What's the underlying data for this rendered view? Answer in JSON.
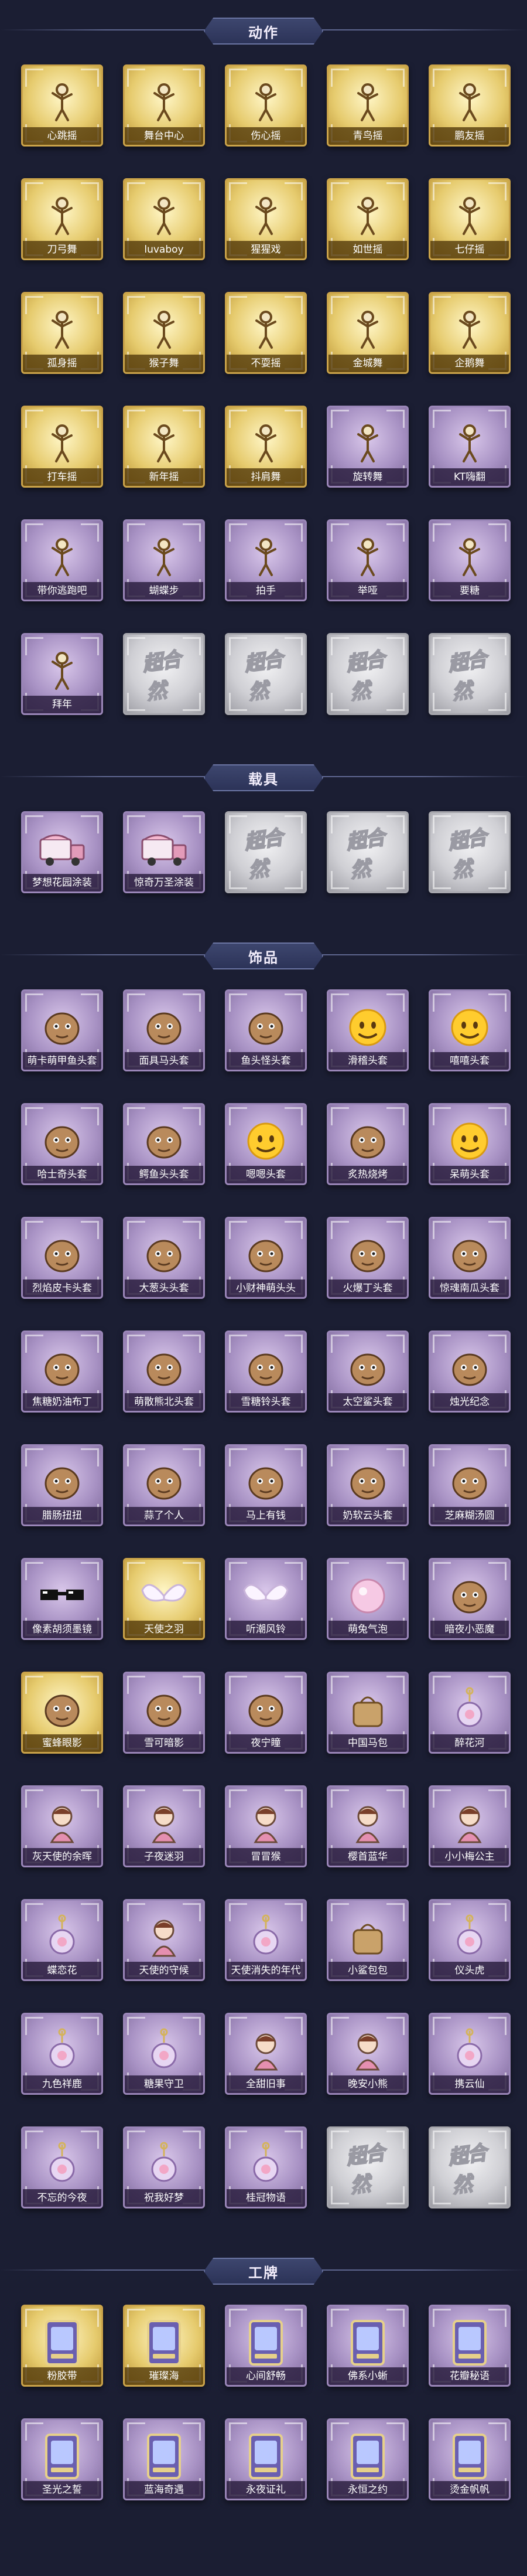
{
  "sections": [
    {
      "title": "动作",
      "items": [
        {
          "label": "心跳摇",
          "tier": "gold",
          "icon": "pose-icon"
        },
        {
          "label": "舞台中心",
          "tier": "gold",
          "icon": "pose-icon"
        },
        {
          "label": "伤心摇",
          "tier": "gold",
          "icon": "pose-icon"
        },
        {
          "label": "青鸟摇",
          "tier": "gold",
          "icon": "pose-icon"
        },
        {
          "label": "鹏友摇",
          "tier": "gold",
          "icon": "pose-icon"
        },
        {
          "label": "刀弓舞",
          "tier": "gold",
          "icon": "pose-icon"
        },
        {
          "label": "luvaboy",
          "tier": "gold",
          "icon": "pose-icon"
        },
        {
          "label": "猩猩戏",
          "tier": "gold",
          "icon": "pose-icon"
        },
        {
          "label": "如世摇",
          "tier": "gold",
          "icon": "pose-icon"
        },
        {
          "label": "七仔摇",
          "tier": "gold",
          "icon": "pose-icon"
        },
        {
          "label": "孤身摇",
          "tier": "gold",
          "icon": "pose-icon"
        },
        {
          "label": "猴子舞",
          "tier": "gold",
          "icon": "pose-icon"
        },
        {
          "label": "不耍摇",
          "tier": "gold",
          "icon": "pose-icon"
        },
        {
          "label": "金城舞",
          "tier": "gold",
          "icon": "pose-icon"
        },
        {
          "label": "企鹅舞",
          "tier": "gold",
          "icon": "pose-icon"
        },
        {
          "label": "打车摇",
          "tier": "gold",
          "icon": "pose-icon"
        },
        {
          "label": "新年摇",
          "tier": "gold",
          "icon": "pose-icon"
        },
        {
          "label": "抖肩舞",
          "tier": "gold",
          "icon": "pose-icon"
        },
        {
          "label": "旋转舞",
          "tier": "purple",
          "icon": "pose-icon"
        },
        {
          "label": "KT嗨翻",
          "tier": "purple",
          "icon": "pose-icon"
        },
        {
          "label": "带你逃跑吧",
          "tier": "purple",
          "icon": "pose-icon"
        },
        {
          "label": "蝴蝶步",
          "tier": "purple",
          "icon": "pose-icon"
        },
        {
          "label": "拍手",
          "tier": "purple",
          "icon": "pose-icon"
        },
        {
          "label": "举哑",
          "tier": "purple",
          "icon": "pose-icon"
        },
        {
          "label": "要糖",
          "tier": "purple",
          "icon": "pose-icon"
        },
        {
          "label": "拜年",
          "tier": "purple",
          "icon": "pose-icon"
        },
        {
          "label": "",
          "tier": "silver",
          "icon": "locked-icon"
        },
        {
          "label": "",
          "tier": "silver",
          "icon": "locked-icon"
        },
        {
          "label": "",
          "tier": "silver",
          "icon": "locked-icon"
        },
        {
          "label": "",
          "tier": "silver",
          "icon": "locked-icon"
        }
      ]
    },
    {
      "title": "载具",
      "items": [
        {
          "label": "梦想花园涂装",
          "tier": "purple",
          "icon": "truck-icon"
        },
        {
          "label": "惊奇万圣涂装",
          "tier": "purple",
          "icon": "truck-icon"
        },
        {
          "label": "",
          "tier": "silver",
          "icon": "locked-icon"
        },
        {
          "label": "",
          "tier": "silver",
          "icon": "locked-icon"
        },
        {
          "label": "",
          "tier": "silver",
          "icon": "locked-icon"
        }
      ]
    },
    {
      "title": "饰品",
      "items": [
        {
          "label": "萌卡萌甲鱼头套",
          "tier": "purple",
          "icon": "head-icon"
        },
        {
          "label": "面具马头套",
          "tier": "purple",
          "icon": "head-icon"
        },
        {
          "label": "鱼头怪头套",
          "tier": "purple",
          "icon": "head-icon"
        },
        {
          "label": "滑稽头套",
          "tier": "purple",
          "icon": "emoji-icon"
        },
        {
          "label": "嘻嘻头套",
          "tier": "purple",
          "icon": "emoji-icon"
        },
        {
          "label": "哈士奇头套",
          "tier": "purple",
          "icon": "head-icon"
        },
        {
          "label": "鳄鱼头头套",
          "tier": "purple",
          "icon": "head-icon"
        },
        {
          "label": "嗯嗯头套",
          "tier": "purple",
          "icon": "emoji-icon"
        },
        {
          "label": "炙热烧烤",
          "tier": "purple",
          "icon": "head-icon"
        },
        {
          "label": "呆萌头套",
          "tier": "purple",
          "icon": "emoji-icon"
        },
        {
          "label": "烈焰皮卡头套",
          "tier": "purple",
          "icon": "head-icon"
        },
        {
          "label": "大葱头头套",
          "tier": "purple",
          "icon": "head-icon"
        },
        {
          "label": "小财神萌头头",
          "tier": "purple",
          "icon": "head-icon"
        },
        {
          "label": "火爆丁头套",
          "tier": "purple",
          "icon": "head-icon"
        },
        {
          "label": "惊魂南瓜头套",
          "tier": "purple",
          "icon": "head-icon"
        },
        {
          "label": "焦糖奶油布丁",
          "tier": "purple",
          "icon": "head-icon"
        },
        {
          "label": "萌散熊北头套",
          "tier": "purple",
          "icon": "head-icon"
        },
        {
          "label": "雪糖铃头套",
          "tier": "purple",
          "icon": "head-icon"
        },
        {
          "label": "太空鲨头套",
          "tier": "purple",
          "icon": "head-icon"
        },
        {
          "label": "烛光纪念",
          "tier": "purple",
          "icon": "head-icon"
        },
        {
          "label": "腊肠扭扭",
          "tier": "purple",
          "icon": "head-icon"
        },
        {
          "label": "蒜了个人",
          "tier": "purple",
          "icon": "head-icon"
        },
        {
          "label": "马上有钱",
          "tier": "purple",
          "icon": "head-icon"
        },
        {
          "label": "奶软云头套",
          "tier": "purple",
          "icon": "head-icon"
        },
        {
          "label": "芝麻糊汤圆",
          "tier": "purple",
          "icon": "head-icon"
        },
        {
          "label": "像素胡须墨镜",
          "tier": "purple",
          "icon": "glasses-icon"
        },
        {
          "label": "天使之羽",
          "tier": "gold",
          "icon": "wings-icon"
        },
        {
          "label": "听潮风铃",
          "tier": "purple",
          "icon": "wings-icon"
        },
        {
          "label": "萌兔气泡",
          "tier": "purple",
          "icon": "bubble-icon"
        },
        {
          "label": "暗夜小恶魔",
          "tier": "purple",
          "icon": "head-icon"
        },
        {
          "label": "蜜蜂眼影",
          "tier": "gold",
          "icon": "head-icon"
        },
        {
          "label": "雪可暗影",
          "tier": "purple",
          "icon": "head-icon"
        },
        {
          "label": "夜宁瞳",
          "tier": "purple",
          "icon": "head-icon"
        },
        {
          "label": "中国马包",
          "tier": "purple",
          "icon": "bag-icon"
        },
        {
          "label": "醉花河",
          "tier": "purple",
          "icon": "charm-icon"
        },
        {
          "label": "灰天使的余晖",
          "tier": "purple",
          "icon": "doll-icon"
        },
        {
          "label": "子夜迷羽",
          "tier": "purple",
          "icon": "doll-icon"
        },
        {
          "label": "冒冒猴",
          "tier": "purple",
          "icon": "doll-icon"
        },
        {
          "label": "樱首蓝华",
          "tier": "purple",
          "icon": "doll-icon"
        },
        {
          "label": "小小梅公主",
          "tier": "purple",
          "icon": "doll-icon"
        },
        {
          "label": "蝶恋花",
          "tier": "purple",
          "icon": "charm-icon"
        },
        {
          "label": "天使的守候",
          "tier": "purple",
          "icon": "doll-icon"
        },
        {
          "label": "天使消失的年代",
          "tier": "purple",
          "icon": "charm-icon"
        },
        {
          "label": "小鲨包包",
          "tier": "purple",
          "icon": "bag-icon"
        },
        {
          "label": "仪头虎",
          "tier": "purple",
          "icon": "charm-icon"
        },
        {
          "label": "九色祥鹿",
          "tier": "purple",
          "icon": "charm-icon"
        },
        {
          "label": "糖果守卫",
          "tier": "purple",
          "icon": "charm-icon"
        },
        {
          "label": "全甜旧事",
          "tier": "purple",
          "icon": "doll-icon"
        },
        {
          "label": "晚安小熊",
          "tier": "purple",
          "icon": "doll-icon"
        },
        {
          "label": "携云仙",
          "tier": "purple",
          "icon": "charm-icon"
        },
        {
          "label": "不忘的今夜",
          "tier": "purple",
          "icon": "charm-icon"
        },
        {
          "label": "祝我好梦",
          "tier": "purple",
          "icon": "charm-icon"
        },
        {
          "label": "桂冠物语",
          "tier": "purple",
          "icon": "charm-icon"
        },
        {
          "label": "",
          "tier": "silver",
          "icon": "locked-icon"
        },
        {
          "label": "",
          "tier": "silver",
          "icon": "locked-icon"
        }
      ]
    },
    {
      "title": "工牌",
      "items": [
        {
          "label": "粉胶带",
          "tier": "gold",
          "icon": "badge-icon"
        },
        {
          "label": "璀璨海",
          "tier": "gold",
          "icon": "badge-icon"
        },
        {
          "label": "心间舒畅",
          "tier": "purple",
          "icon": "badge-icon"
        },
        {
          "label": "佛系小蜥",
          "tier": "purple",
          "icon": "badge-icon"
        },
        {
          "label": "花瓣秘语",
          "tier": "purple",
          "icon": "badge-icon"
        },
        {
          "label": "圣光之誓",
          "tier": "purple",
          "icon": "badge-icon"
        },
        {
          "label": "蓝海奇遇",
          "tier": "purple",
          "icon": "badge-icon"
        },
        {
          "label": "永夜证礼",
          "tier": "purple",
          "icon": "badge-icon"
        },
        {
          "label": "永恒之约",
          "tier": "purple",
          "icon": "badge-icon"
        },
        {
          "label": "烫金帆帆",
          "tier": "purple",
          "icon": "badge-icon"
        }
      ]
    }
  ],
  "watermark": "超合然"
}
